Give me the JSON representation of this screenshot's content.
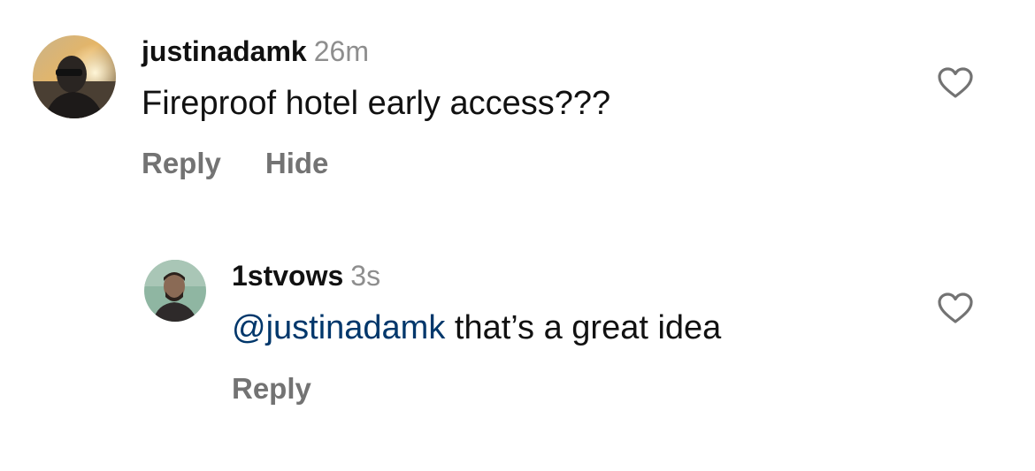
{
  "comments": [
    {
      "username": "justinadamk",
      "time": "26m",
      "text": "Fireproof hotel early access???",
      "actions": {
        "reply": "Reply",
        "hide": "Hide"
      },
      "avatar_icon": "user-avatar-sunset",
      "like_icon": "heart-outline-icon"
    },
    {
      "username": "1stvows",
      "time": "3s",
      "mention": "@justinadamk",
      "text": " that’s a great idea",
      "actions": {
        "reply": "Reply"
      },
      "avatar_icon": "user-avatar-portrait",
      "like_icon": "heart-outline-icon"
    }
  ],
  "colors": {
    "username": "#111111",
    "timestamp": "#8e8e8e",
    "action": "#737373",
    "mention": "#00376b",
    "heart_stroke": "#737373"
  }
}
